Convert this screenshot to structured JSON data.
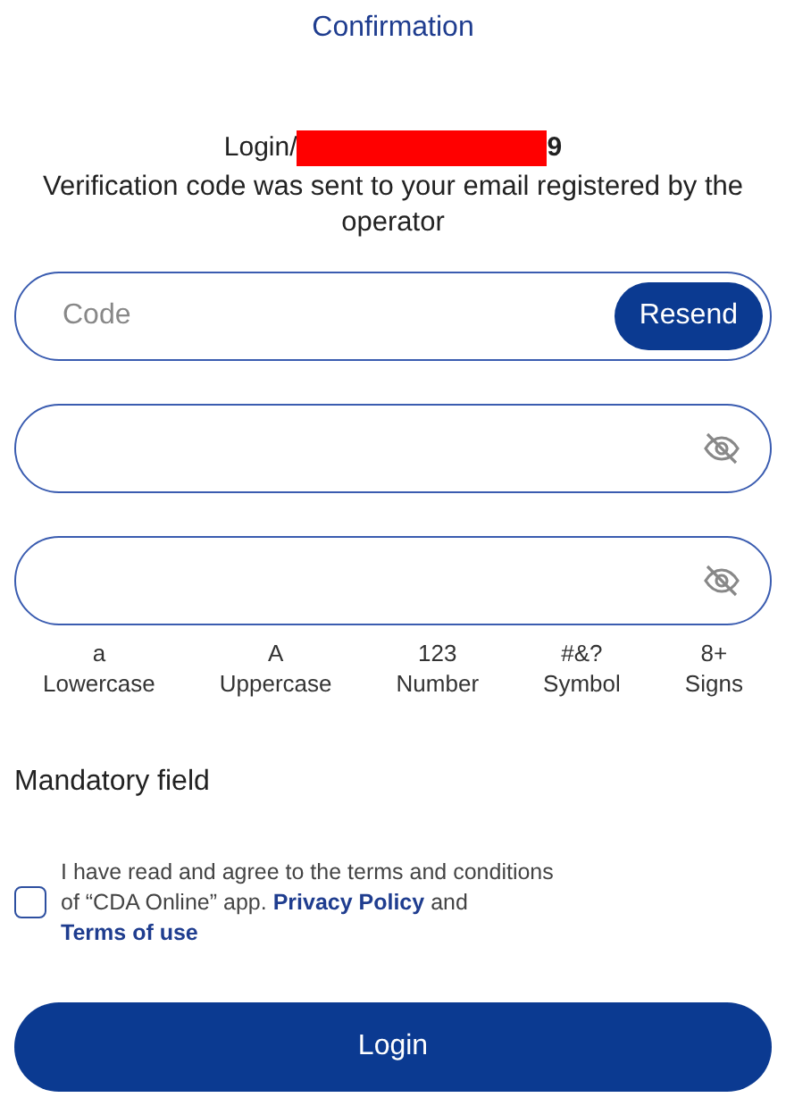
{
  "header": {
    "title": "Confirmation"
  },
  "login": {
    "prefix": "Login/",
    "suffix": "9",
    "redacted": true
  },
  "message": "Verification code was sent to your email registered by the operator",
  "code_field": {
    "placeholder": "Code",
    "button": "Resend"
  },
  "password_fields": [
    {
      "kind": "password"
    },
    {
      "kind": "password"
    }
  ],
  "hints": [
    {
      "symbol": "a",
      "label": "Lowercase"
    },
    {
      "symbol": "A",
      "label": "Uppercase"
    },
    {
      "symbol": "123",
      "label": "Number"
    },
    {
      "symbol": "#&?",
      "label": "Symbol"
    },
    {
      "symbol": "8+",
      "label": "Signs"
    }
  ],
  "mandatory_note": "Mandatory field",
  "agreement": {
    "checked": false,
    "text": "I have read and agree to the terms and conditions of “CDA Online” app.",
    "link_1": "Privacy Policy",
    "joiner": "and",
    "link_2": "Terms of use"
  },
  "login_button": "Login"
}
